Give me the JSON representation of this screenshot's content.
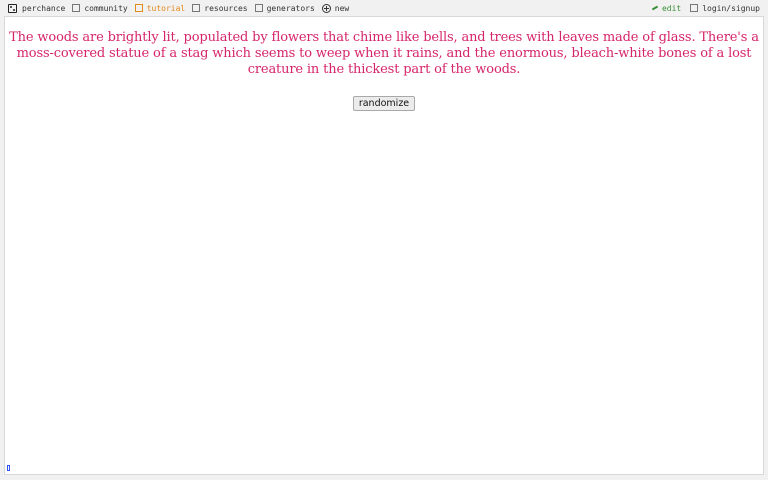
{
  "nav": {
    "left": [
      {
        "label": "perchance",
        "icon": "dice-icon"
      },
      {
        "label": "community",
        "icon": "community-icon"
      },
      {
        "label": "tutorial",
        "icon": "tutorial-icon",
        "accent": "#e38a1c"
      },
      {
        "label": "resources",
        "icon": "resources-icon"
      },
      {
        "label": "generators",
        "icon": "generators-icon"
      },
      {
        "label": "new",
        "icon": "plus-circle-icon"
      }
    ],
    "right": [
      {
        "label": "edit",
        "icon": "pencil-icon",
        "accent": "#3a8e3a"
      },
      {
        "label": "login/signup",
        "icon": "login-icon"
      }
    ]
  },
  "main": {
    "story": "The woods are brightly lit, populated by flowers that chime like bells, and trees with leaves made of glass. There's a moss-covered statue of a stag which seems to weep when it rains, and the enormous, bleach-white bones of a lost creature in the thickest part of the woods.",
    "story_color": "#d6246a",
    "button_label": "randomize"
  }
}
